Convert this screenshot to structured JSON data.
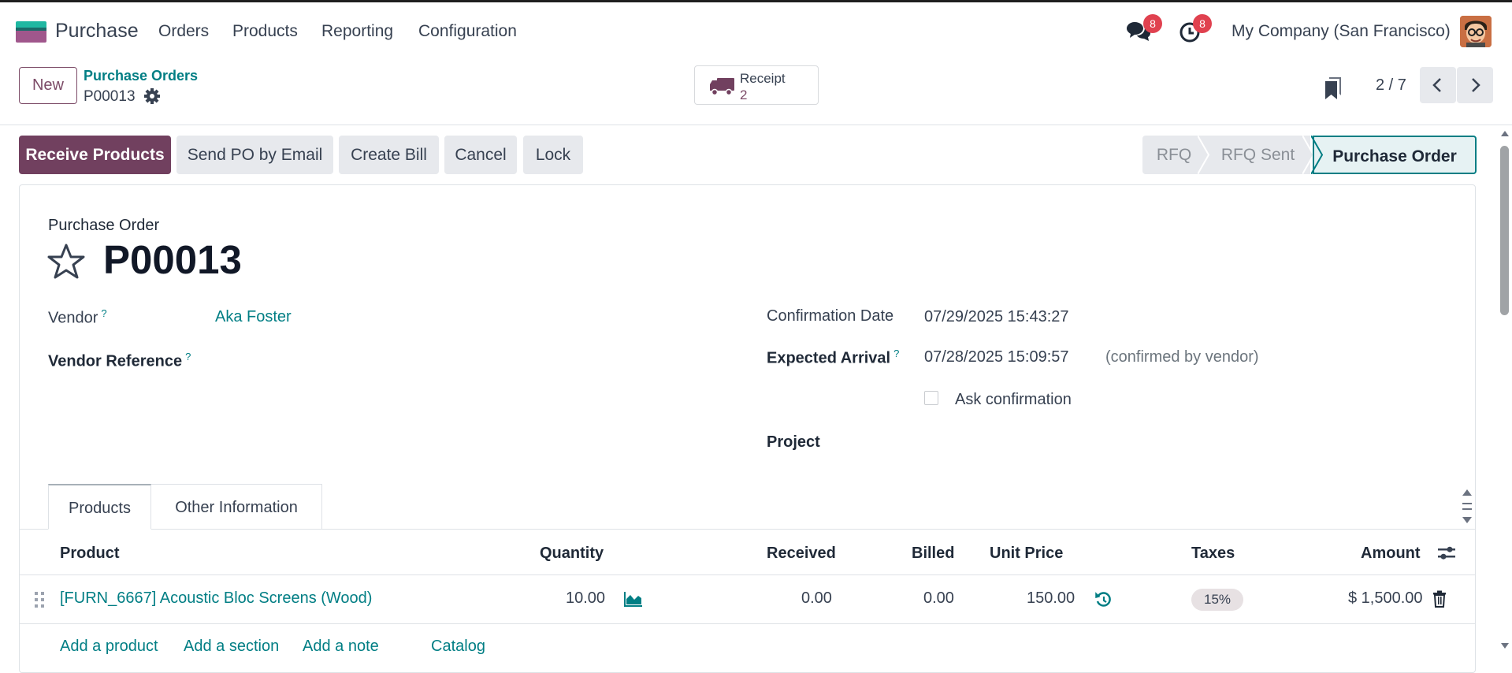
{
  "navbar": {
    "app_name": "Purchase",
    "menu": [
      "Orders",
      "Products",
      "Reporting",
      "Configuration"
    ],
    "messages_count": "8",
    "activities_count": "8",
    "company": "My Company (San Francisco)"
  },
  "control_panel": {
    "new_label": "New",
    "breadcrumb": "Purchase Orders",
    "record_name": "P00013",
    "smart_button": {
      "label": "Receipt",
      "value": "2"
    },
    "pager": "2 / 7"
  },
  "statusbar": {
    "buttons": [
      "Receive Products",
      "Send PO by Email",
      "Create Bill",
      "Cancel",
      "Lock"
    ],
    "stages": [
      "RFQ",
      "RFQ Sent",
      "Purchase Order"
    ],
    "active_stage": "Purchase Order"
  },
  "form": {
    "title_label": "Purchase Order",
    "name": "P00013",
    "vendor_label": "Vendor",
    "vendor_value": "Aka Foster",
    "vendor_ref_label": "Vendor Reference",
    "help_mark": "?",
    "confirmation_date_label": "Confirmation Date",
    "confirmation_date_value": "07/29/2025 15:43:27",
    "expected_arrival_label": "Expected Arrival",
    "expected_arrival_value": "07/28/2025 15:09:57",
    "expected_arrival_note": "(confirmed by vendor)",
    "ask_confirmation_label": "Ask confirmation",
    "project_label": "Project"
  },
  "tabs": [
    "Products",
    "Other Information"
  ],
  "order_lines": {
    "columns": [
      "Product",
      "Quantity",
      "Received",
      "Billed",
      "Unit Price",
      "Taxes",
      "Amount"
    ],
    "rows": [
      {
        "product": "[FURN_6667] Acoustic Bloc Screens (Wood)",
        "quantity": "10.00",
        "received": "0.00",
        "billed": "0.00",
        "unit_price": "150.00",
        "taxes": "15%",
        "amount": "$ 1,500.00"
      }
    ],
    "add_links": [
      "Add a product",
      "Add a section",
      "Add a note",
      "Catalog"
    ]
  },
  "colors": {
    "primary": "#71405f",
    "link": "#017e84",
    "badge": "#e0414f"
  }
}
